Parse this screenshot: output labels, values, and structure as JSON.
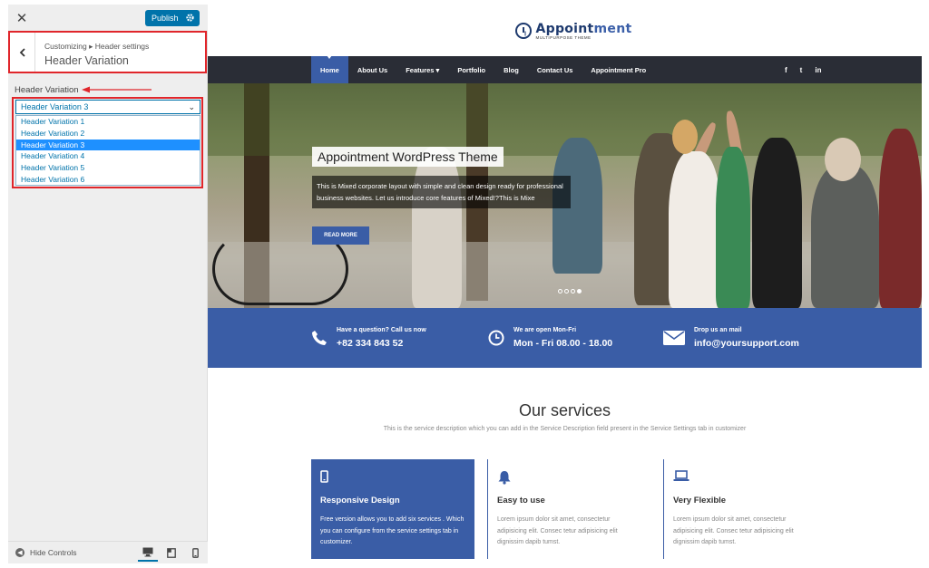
{
  "customizer": {
    "close_icon": "close-icon",
    "publish_label": "Publish",
    "breadcrumb": "Customizing ▸ Header settings",
    "section_title": "Header Variation",
    "control_label": "Header Variation",
    "selected_value": "Header Variation 3",
    "options": [
      "Header Variation 1",
      "Header Variation 2",
      "Header Variation 3",
      "Header Variation 4",
      "Header Variation 5",
      "Header Variation 6"
    ],
    "selected_index": 2,
    "hide_controls_label": "Hide Controls",
    "devices": [
      "desktop-icon",
      "tablet-icon",
      "mobile-icon"
    ],
    "accent_color": "#0073aa",
    "highlight_color": "#e0262b"
  },
  "site": {
    "logo_name_a": "Appoint",
    "logo_name_b": "ment",
    "logo_tagline": "MULTIPURPOSE THEME",
    "nav": [
      "Home",
      "About Us",
      "Features ▾",
      "Portfolio",
      "Blog",
      "Contact Us",
      "Appointment Pro"
    ],
    "social": [
      "f",
      "t",
      "in"
    ],
    "hero": {
      "title": "Appointment WordPress Theme",
      "description": "This is Mixed corporate layout with simple and clean design ready for professional business websites. Let us introduce core features of Mixed!?This is Mixe",
      "button": "READ MORE"
    },
    "contacts": [
      {
        "icon": "phone-icon",
        "label": "Have a question? Call us now",
        "value": "+82 334 843 52"
      },
      {
        "icon": "clock-icon",
        "label": "We are open Mon-Fri",
        "value": "Mon - Fri 08.00 - 18.00"
      },
      {
        "icon": "mail-icon",
        "label": "Drop us an mail",
        "value": "info@yoursupport.com"
      }
    ],
    "services": {
      "title": "Our services",
      "description": "This is the service description which you can add in the Service Description field present in the Service Settings tab in customizer",
      "items": [
        {
          "icon": "mobile-icon",
          "name": "Responsive Design",
          "text": "Free version allows you to add six services . Which you can configure from the service settings tab in customizer."
        },
        {
          "icon": "bell-icon",
          "name": "Easy to use",
          "text": "Lorem ipsum dolor sit amet, consectetur adipisicing elit. Consec tetur adipisicing elit dignissim dapib tumst."
        },
        {
          "icon": "laptop-icon",
          "name": "Very Flexible",
          "text": "Lorem ipsum dolor sit amet, consectetur adipisicing elit. Consec tetur adipisicing elit dignissim dapib tumst."
        }
      ]
    },
    "brand_color": "#3a5da6",
    "nav_bg": "#2a2d36"
  }
}
